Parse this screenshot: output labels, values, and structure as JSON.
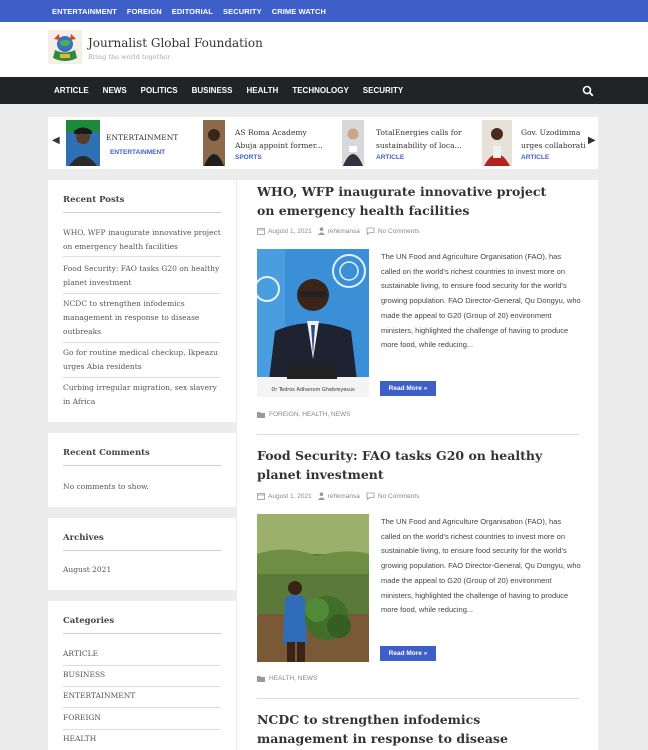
{
  "top_links": [
    "ENTERTAINMENT",
    "FOREIGN",
    "EDITORIAL",
    "SECURITY",
    "CRIME WATCH"
  ],
  "site": {
    "title": "Journalist Global Foundation",
    "tagline": "Bring the world together"
  },
  "nav": [
    "ARTICLE",
    "NEWS",
    "POLITICS",
    "BUSINESS",
    "HEALTH",
    "TECHNOLOGY",
    "SECURITY"
  ],
  "ticker": [
    {
      "title": "ENTERTAINMENT",
      "title2": "",
      "category": "ENTERTAINMENT"
    },
    {
      "title": "AS Roma Academy",
      "title2": "Abuja appoint former...",
      "category": "SPORTS"
    },
    {
      "title": "TotalEnergies calls for",
      "title2": "sustainability of loca...",
      "category": "ARTICLE"
    },
    {
      "title": "Gov. Uzodimma",
      "title2": "urges collaborati",
      "category": "ARTICLE"
    }
  ],
  "sidebar": {
    "recent_posts_title": "Recent Posts",
    "recent_posts": [
      "WHO, WFP inaugurate innovative project on emergency health facilities",
      "Food Security: FAO tasks G20 on healthy planet investment",
      "NCDC to strengthen infodemics management in response to disease outbreaks",
      "Go for routine medical checkup, Ikpeazu urges Abia residents",
      "Curbing irregular migration, sex slavery in Africa"
    ],
    "recent_comments_title": "Recent Comments",
    "no_comments": "No comments to show.",
    "archives_title": "Archives",
    "archives": [
      "August 2021"
    ],
    "categories_title": "Categories",
    "categories": [
      "ARTICLE",
      "BUSINESS",
      "ENTERTAINMENT",
      "FOREIGN",
      "HEALTH"
    ]
  },
  "posts": [
    {
      "title": "WHO, WFP inaugurate innovative project on emergency health facilities",
      "date": "August 1, 2021",
      "author": "rehkmansa",
      "comments": "No Comments",
      "excerpt": "The UN Food and Agriculture Organisation (FAO), has called on the world's richest countries to invest more on sustainable living, to ensure food security for the world's growing population. FAO Director-General, Qu Dongyu, who made the appeal to G20 (Group of 20) environment ministers, highlighted the challenge of having to produce more food, while reducing...",
      "read_more": "Read More »",
      "categories": "FOREIGN, HEALTH, NEWS",
      "image_caption": "Dr Tedros Adhanom Ghebreyesus"
    },
    {
      "title": "Food Security: FAO tasks G20 on healthy planet investment",
      "date": "August 1, 2021",
      "author": "rehkmansa",
      "comments": "No Comments",
      "excerpt": "The UN Food and Agriculture Organisation (FAO), has called on the world's richest countries to invest more on sustainable living, to ensure food security for the world's growing population. FAO Director-General, Qu Dongyu, who made the appeal to G20 (Group of 20) environment ministers, highlighted the challenge of having to produce more food, while reducing...",
      "read_more": "Read More »",
      "categories": "HEALTH, NEWS"
    },
    {
      "title": "NCDC to strengthen infodemics management in response to disease outbreaks"
    }
  ],
  "colors": {
    "accent": "#3f5fc8",
    "navbar": "#222326",
    "background": "#ececec"
  }
}
